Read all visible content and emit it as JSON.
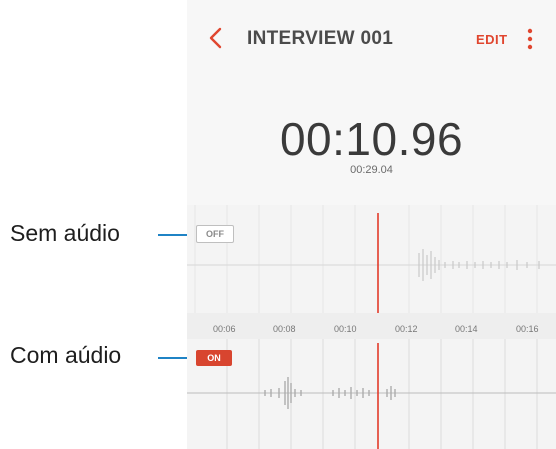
{
  "callouts": {
    "off_label": "Sem aúdio",
    "on_label": "Com aúdio"
  },
  "header": {
    "title": "INTERVIEW 001",
    "edit_label": "EDIT"
  },
  "recording": {
    "current_time": "00:10.96",
    "total_time": "00:29.04"
  },
  "tracks": {
    "muted_badge": "OFF",
    "active_badge": "ON"
  },
  "timeline": {
    "ticks": [
      "00:06",
      "00:08",
      "00:10",
      "00:12",
      "00:14",
      "00:16"
    ]
  },
  "colors": {
    "accent": "#e0462f",
    "leader": "#1f83c5"
  }
}
